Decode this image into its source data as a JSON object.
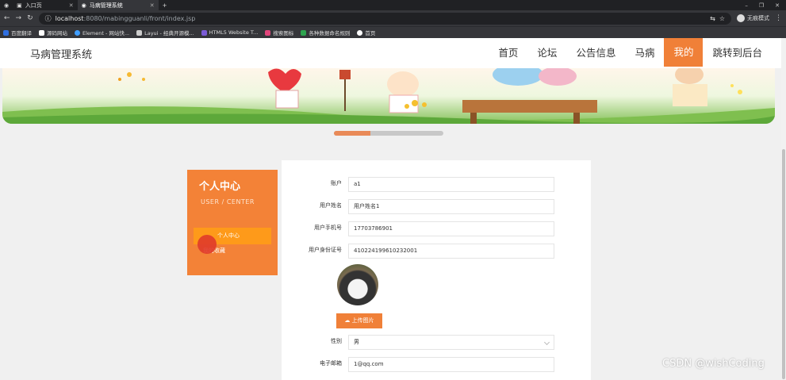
{
  "browser": {
    "tabs": [
      {
        "title": "入口页"
      },
      {
        "title": "马病管理系统"
      }
    ],
    "new_tab": "+",
    "url_host": "localhost",
    "url_path": ":8080/mabingguanli/front/index.jsp",
    "profile_label": "无痕模式",
    "bookmarks": [
      "百度翻译",
      "源码网站",
      "Element - 网站快...",
      "Layui - 经典开源模...",
      "HTML5 Website T...",
      "搜索图标",
      "各种数据命名规则",
      "首页"
    ]
  },
  "site": {
    "brand": "马病管理系统",
    "menu": [
      "首页",
      "论坛",
      "公告信息",
      "马病",
      "我的",
      "跳转到后台"
    ],
    "active_menu": "我的"
  },
  "sidebar": {
    "title": "个人中心",
    "subtitle": "USER / CENTER",
    "items": [
      "个人中心",
      "我的收藏"
    ]
  },
  "form": {
    "fields": [
      {
        "label": "账户",
        "value": "a1"
      },
      {
        "label": "用户姓名",
        "value": "用户姓名1"
      },
      {
        "label": "用户手机号",
        "value": "17703786901"
      },
      {
        "label": "用户身份证号",
        "value": "410224199610232001"
      }
    ],
    "upload_label": "上传图片",
    "gender_label": "性别",
    "gender_value": "男",
    "email_label": "电子邮箱",
    "email_value": "1@qq.com"
  },
  "watermark": "CSDN @wishCoding"
}
